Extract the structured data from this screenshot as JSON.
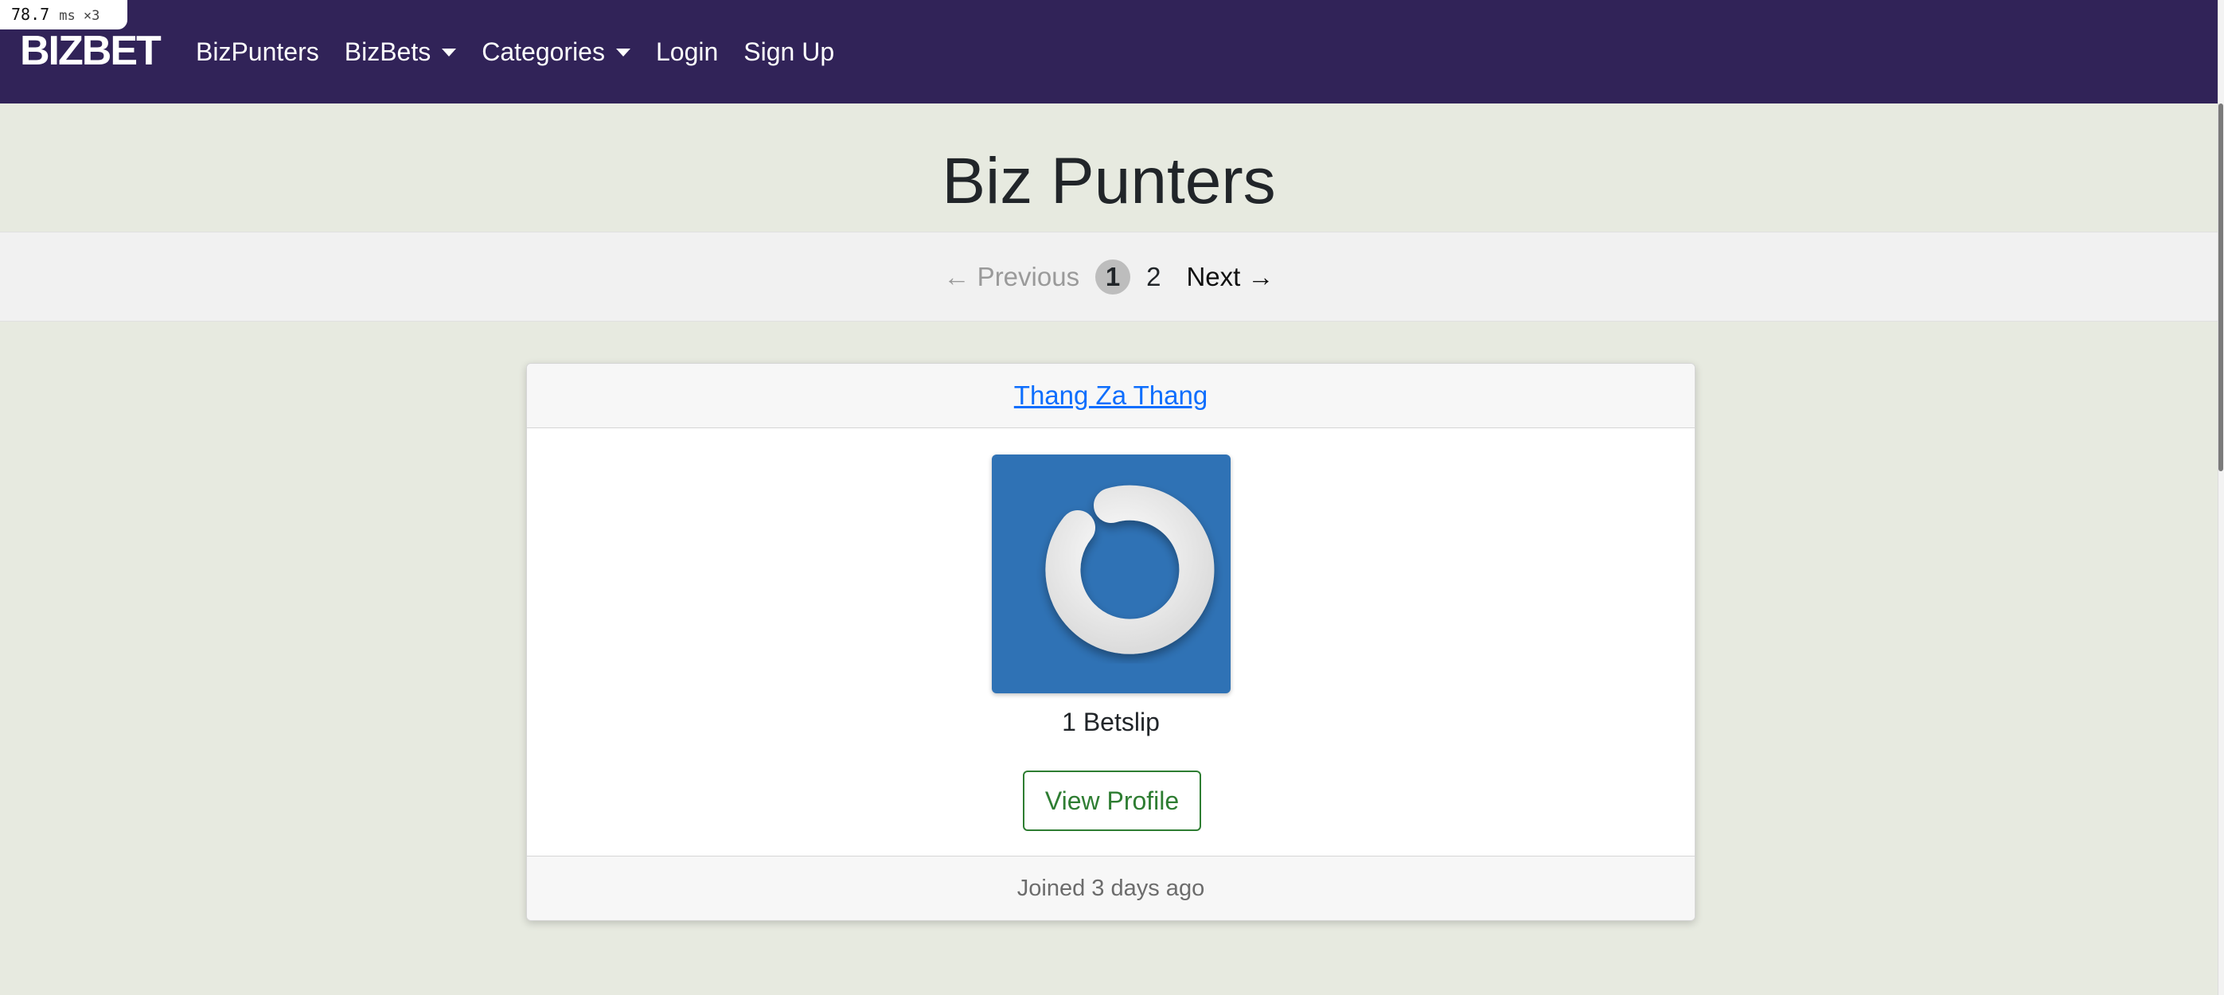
{
  "perf_badge": {
    "value": "78.7",
    "unit": "ms ×3"
  },
  "navbar": {
    "brand": "BIZBET",
    "items": [
      {
        "label": "BizPunters",
        "dropdown": false
      },
      {
        "label": "BizBets",
        "dropdown": true
      },
      {
        "label": "Categories",
        "dropdown": true
      },
      {
        "label": "Login",
        "dropdown": false
      },
      {
        "label": "Sign Up",
        "dropdown": false
      }
    ]
  },
  "page": {
    "title": "Biz Punters"
  },
  "pagination": {
    "previous_label": "← Previous",
    "current_page": "1",
    "other_page": "2",
    "next_label": "Next →"
  },
  "punter_card": {
    "name": "Thang Za Thang",
    "betslip_count": "1 Betslip",
    "view_profile_label": "View Profile",
    "joined": "Joined 3 days ago",
    "avatar_icon": "gravatar-power-icon"
  },
  "colors": {
    "navbar_bg": "#312358",
    "page_bg": "#e7eae0",
    "link": "#0d6efd",
    "button_outline": "#2e7d32",
    "avatar_bg": "#2f72b5"
  }
}
